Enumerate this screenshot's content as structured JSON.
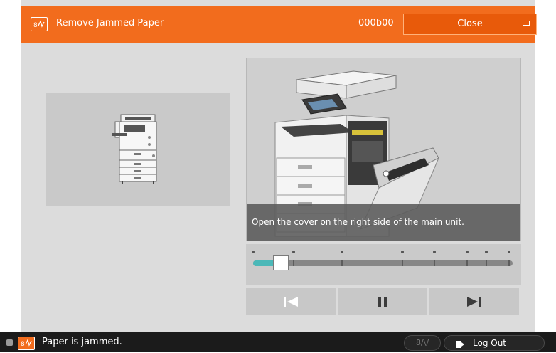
{
  "header": {
    "title": "Remove Jammed Paper",
    "code": "000b00",
    "close_label": "Close",
    "icon": "error-code-icon"
  },
  "main_image": {
    "caption": "Open the cover on the right side of the main unit."
  },
  "progress": {
    "fraction": 0.108,
    "step_markers": [
      0.0,
      0.155,
      0.342,
      0.575,
      0.699,
      0.826,
      0.899,
      0.986
    ]
  },
  "controls": {
    "rewind_icon": "skip-to-start-icon",
    "pause_icon": "pause-icon",
    "next_icon": "skip-to-end-icon"
  },
  "status": {
    "text": "Paper is jammed.",
    "error_icon_label": "8/\\/",
    "logout_label": "Log Out"
  },
  "colors": {
    "accent": "#f26c1d",
    "progress": "#4bb8b8"
  }
}
